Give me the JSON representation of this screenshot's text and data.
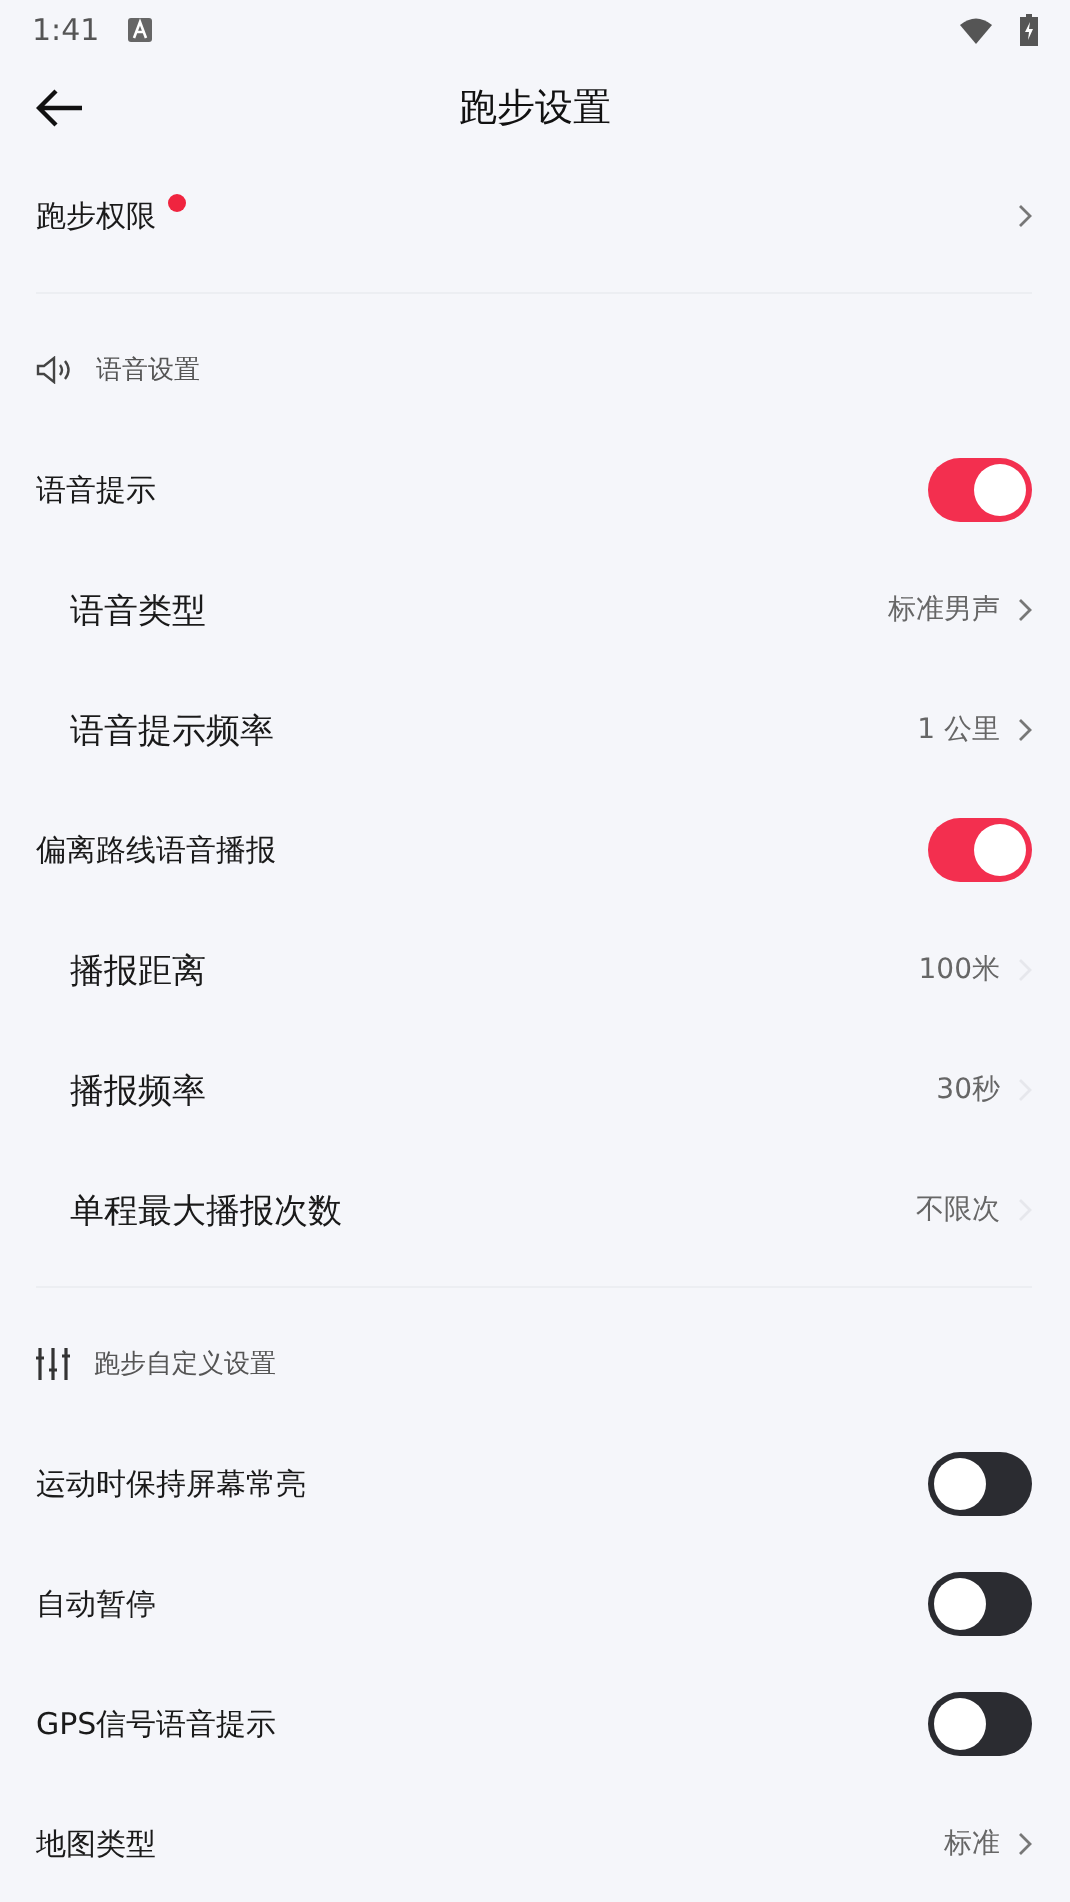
{
  "status_bar": {
    "time": "1:41"
  },
  "header": {
    "title": "跑步设置"
  },
  "sections": [
    {
      "items": [
        {
          "kind": "link",
          "label": "跑步权限",
          "badge": true,
          "sub": false
        }
      ]
    },
    {
      "title": "语音设置",
      "items": [
        {
          "kind": "toggle",
          "label": "语音提示",
          "on": true,
          "sub": false
        },
        {
          "kind": "link",
          "label": "语音类型",
          "value": "标准男声",
          "sub": true,
          "disabled": false
        },
        {
          "kind": "link",
          "label": "语音提示频率",
          "value": "1 公里",
          "sub": true,
          "disabled": false
        },
        {
          "kind": "toggle",
          "label": "偏离路线语音播报",
          "on": true,
          "sub": false
        },
        {
          "kind": "link",
          "label": "播报距离",
          "value": "100米",
          "sub": true,
          "disabled": true
        },
        {
          "kind": "link",
          "label": "播报频率",
          "value": "30秒",
          "sub": true,
          "disabled": true
        },
        {
          "kind": "link",
          "label": "单程最大播报次数",
          "value": "不限次",
          "sub": true,
          "disabled": true
        }
      ]
    },
    {
      "title": "跑步自定义设置",
      "items": [
        {
          "kind": "toggle",
          "label": "运动时保持屏幕常亮",
          "on": false,
          "sub": false
        },
        {
          "kind": "toggle",
          "label": "自动暂停",
          "on": false,
          "sub": false
        },
        {
          "kind": "toggle",
          "label": "GPS信号语音提示",
          "on": false,
          "sub": false
        },
        {
          "kind": "link",
          "label": "地图类型",
          "value": "标准",
          "sub": false,
          "disabled": false
        }
      ]
    }
  ]
}
